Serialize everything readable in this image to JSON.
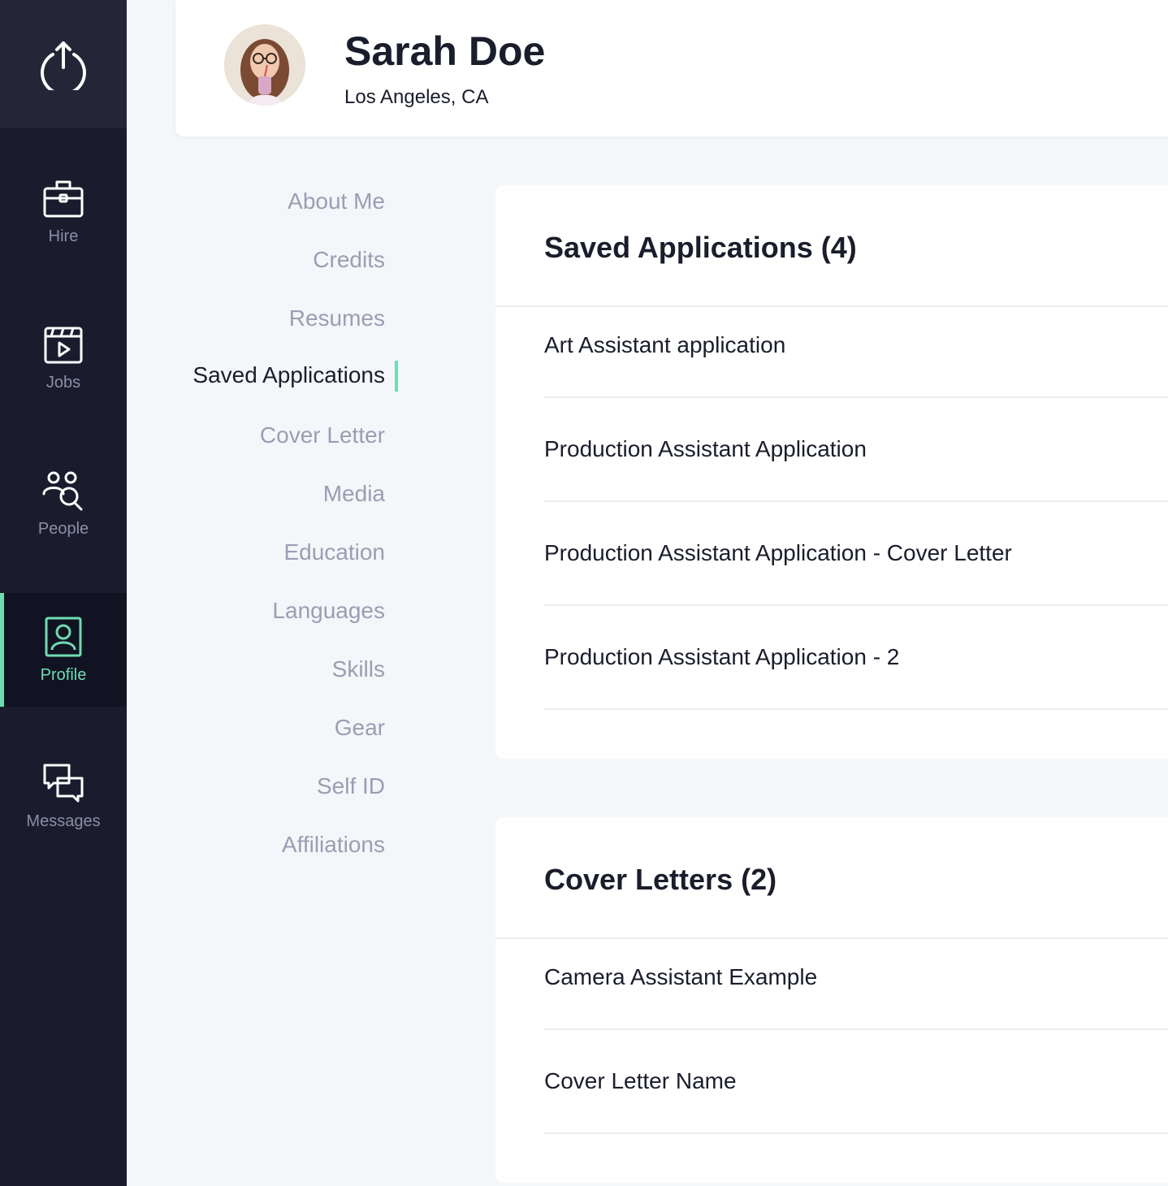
{
  "colors": {
    "sidebar_bg": "#1a1c2e",
    "accent": "#6fdcb2",
    "page_bg": "#f5f6fa"
  },
  "sidebar": {
    "logo_icon": "power-upload-icon",
    "items": [
      {
        "label": "Hire",
        "icon": "briefcase-icon"
      },
      {
        "label": "Jobs",
        "icon": "clapperboard-play-icon"
      },
      {
        "label": "People",
        "icon": "people-search-icon"
      },
      {
        "label": "Profile",
        "icon": "profile-card-icon",
        "active": true
      },
      {
        "label": "Messages",
        "icon": "chat-bubbles-icon"
      }
    ]
  },
  "profile": {
    "name": "Sarah Doe",
    "location": "Los Angeles, CA"
  },
  "section_menu": {
    "items": [
      "About Me",
      "Credits",
      "Resumes",
      "Saved Applications",
      "Cover Letter",
      "Media",
      "Education",
      "Languages",
      "Skills",
      "Gear",
      "Self ID",
      "Affiliations"
    ],
    "active": "Saved Applications"
  },
  "saved_applications": {
    "title": "Saved Applications (4)",
    "items": [
      "Art Assistant application",
      "Production Assistant Application",
      "Production Assistant Application - Cover Letter",
      "Production Assistant Application - 2"
    ]
  },
  "cover_letters": {
    "title": "Cover Letters (2)",
    "items": [
      "Camera Assistant Example",
      "Cover Letter Name"
    ]
  }
}
